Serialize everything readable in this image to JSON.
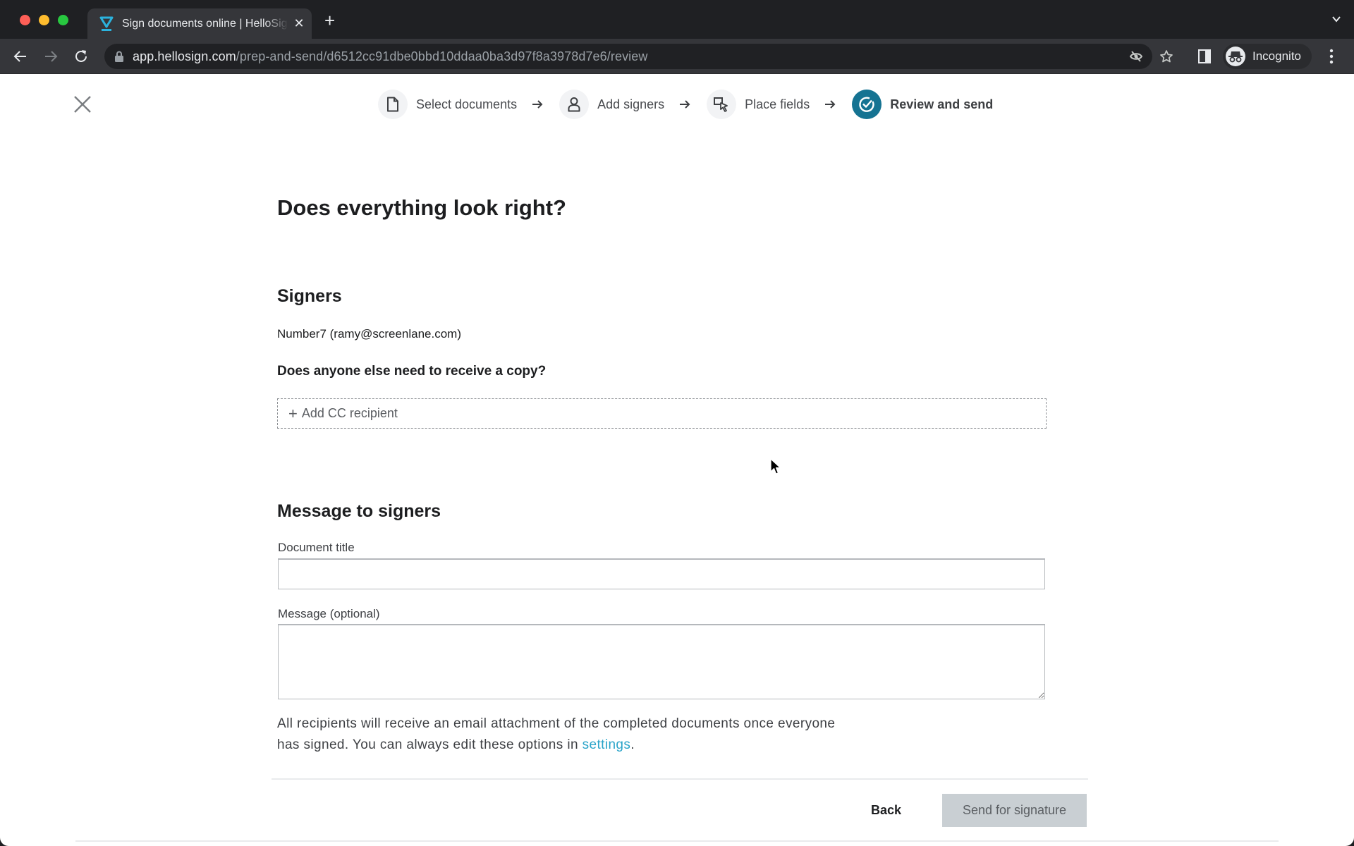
{
  "browser": {
    "tab": {
      "title": "Sign documents online | HelloSign",
      "favicon": "hellosign-logo-icon"
    },
    "url": {
      "host": "app.hellosign.com",
      "path": "/prep-and-send/d6512cc91dbe0bbd10ddaa0ba3d97f8a3978d7e6/review"
    },
    "profile_label": "Incognito",
    "icons": [
      "back-icon",
      "forward-icon",
      "reload-icon",
      "lock-icon",
      "eye-off-icon",
      "star-icon",
      "side-panel-icon",
      "incognito-icon",
      "kebab-menu-icon",
      "new-tab-icon",
      "tab-list-chevron-icon"
    ]
  },
  "colors": {
    "accent": "#157392",
    "link": "#2aa4c9",
    "disabled_button": "#c9cfd3"
  },
  "stepper": {
    "steps": [
      {
        "label": "Select documents",
        "icon": "document-icon",
        "state": "done"
      },
      {
        "label": "Add signers",
        "icon": "person-icon",
        "state": "done"
      },
      {
        "label": "Place fields",
        "icon": "place-field-icon",
        "state": "done"
      },
      {
        "label": "Review and send",
        "icon": "check-circle-icon",
        "state": "active"
      }
    ]
  },
  "page": {
    "heading": "Does everything look right?",
    "signers": {
      "title": "Signers",
      "list": [
        "Number7 (ramy@screenlane.com)"
      ]
    },
    "cc": {
      "question": "Does anyone else need to receive a copy?",
      "add_label": "Add CC recipient",
      "add_icon": "+"
    },
    "message": {
      "title": "Message to signers",
      "document_title_label": "Document title",
      "document_title_value": "",
      "message_label": "Message (optional)",
      "message_value": ""
    },
    "note": {
      "text": "All recipients will receive an email attachment of the completed documents once everyone has signed. You can always edit these options in ",
      "link": "settings",
      "suffix": "."
    },
    "actions": {
      "back": "Back",
      "send": "Send for signature"
    }
  }
}
